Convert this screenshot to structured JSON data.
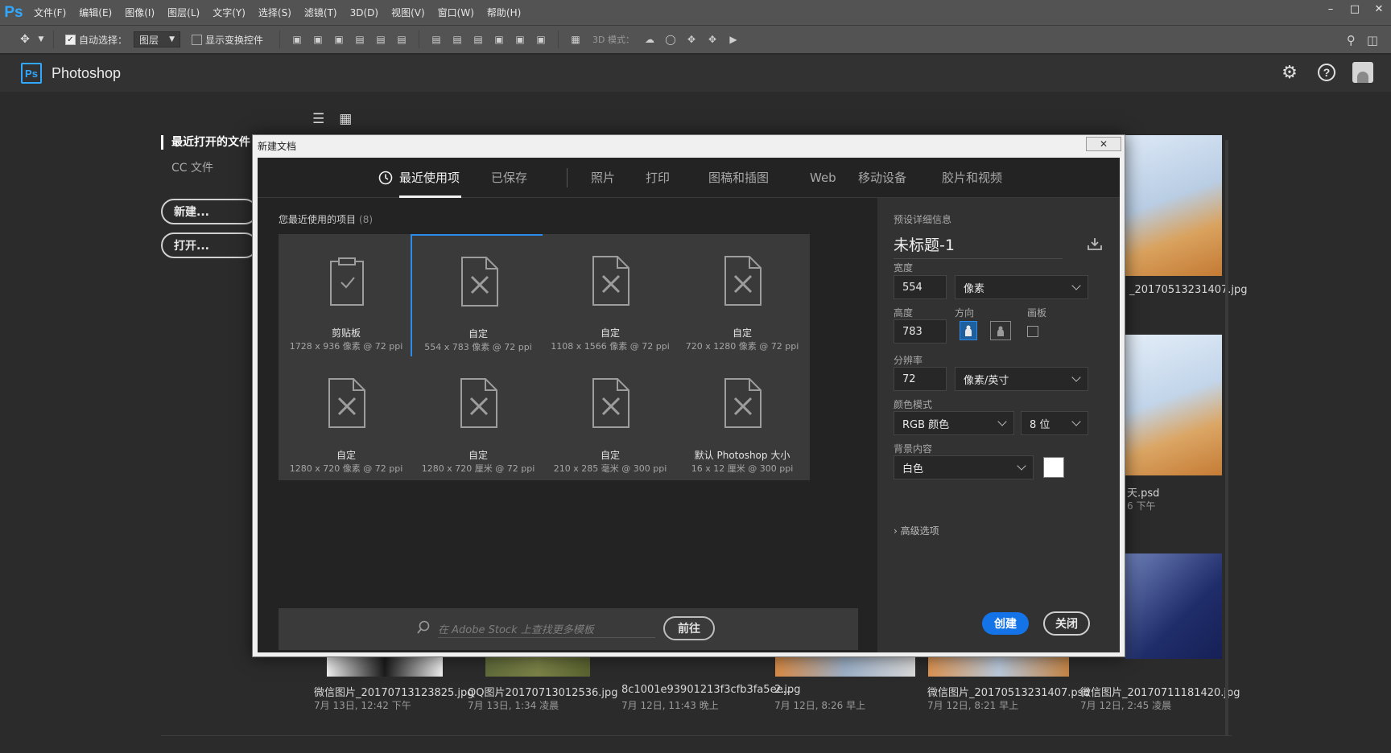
{
  "app": {
    "logo": "Ps",
    "menu": [
      "文件(F)",
      "编辑(E)",
      "图像(I)",
      "图层(L)",
      "文字(Y)",
      "选择(S)",
      "滤镜(T)",
      "3D(D)",
      "视图(V)",
      "窗口(W)",
      "帮助(H)"
    ]
  },
  "options_bar": {
    "auto_select_label": "自动选择：",
    "auto_select_value": "图层",
    "show_transform_label": "显示变换控件",
    "mode_3d_label": "3D 模式："
  },
  "start": {
    "badge": "Ps",
    "app_name": "Photoshop",
    "recent_files_label": "最近打开的文件",
    "cc_files_label": "CC 文件",
    "new_button": "新建...",
    "open_button": "打开...",
    "recent_items": [
      {
        "name": "微信图片_20170713123825.jpg",
        "date": "7月 13日, 12:42 下午"
      },
      {
        "name": "QQ图片20170713012536.jpg",
        "date": "7月 13日, 1:34 凌晨"
      },
      {
        "name": "8c1001e93901213f3cfb3fa5ee...",
        "date": "7月 12日, 11:43 晚上"
      },
      {
        "name": "2.jpg",
        "date": "7月 12日, 8:26 早上"
      },
      {
        "name": "微信图片_20170513231407.psd",
        "date": "7月 12日, 8:21 早上"
      },
      {
        "name": "微信图片_20170711181420.jpg",
        "date": "7月 12日, 2:45 凌晨"
      }
    ],
    "right_col": [
      {
        "name": "_20170513231407.jpg"
      },
      {
        "name": "天.psd",
        "date": "6 下午"
      }
    ]
  },
  "dialog": {
    "title": "新建文档",
    "tabs": [
      "最近使用项",
      "已保存",
      "照片",
      "打印",
      "图稿和插图",
      "Web",
      "移动设备",
      "胶片和视频"
    ],
    "recent_heading": "您最近使用的项目",
    "recent_count": "(8)",
    "presets": [
      {
        "name": "剪贴板",
        "desc": "1728 x 936 像素 @ 72 ppi",
        "icon": "clipboard-icon"
      },
      {
        "name": "自定",
        "desc": "554 x 783 像素 @ 72 ppi",
        "icon": "custom-doc-icon",
        "selected": true
      },
      {
        "name": "自定",
        "desc": "1108 x 1566 像素 @ 72 ppi",
        "icon": "custom-doc-icon"
      },
      {
        "name": "自定",
        "desc": "720 x 1280 像素 @ 72 ppi",
        "icon": "custom-doc-icon"
      },
      {
        "name": "自定",
        "desc": "1280 x 720 像素 @ 72 ppi",
        "icon": "custom-doc-icon"
      },
      {
        "name": "自定",
        "desc": "1280 x 720 厘米 @ 72 ppi",
        "icon": "custom-doc-icon"
      },
      {
        "name": "自定",
        "desc": "210 x 285 毫米 @ 300 ppi",
        "icon": "custom-doc-icon"
      },
      {
        "name": "默认 Photoshop 大小",
        "desc": "16 x 12 厘米 @ 300 ppi",
        "icon": "custom-doc-icon"
      }
    ],
    "stock_placeholder": "在 Adobe Stock 上查找更多模板",
    "stock_go": "前往",
    "details": {
      "heading": "预设详细信息",
      "doc_name": "未标题-1",
      "width_label": "宽度",
      "width_value": "554",
      "width_unit": "像素",
      "height_label": "高度",
      "height_value": "783",
      "orientation_label": "方向",
      "artboard_label": "画板",
      "resolution_label": "分辨率",
      "resolution_value": "72",
      "resolution_unit": "像素/英寸",
      "color_mode_label": "颜色模式",
      "color_mode_value": "RGB 颜色",
      "bit_depth": "8 位",
      "background_label": "背景内容",
      "background_value": "白色",
      "advanced": "高级选项",
      "create": "创建",
      "close": "关闭"
    }
  },
  "colors": {
    "accent": "#1473e6",
    "selection": "#2d8ceb",
    "ps_blue": "#31a8ff"
  }
}
